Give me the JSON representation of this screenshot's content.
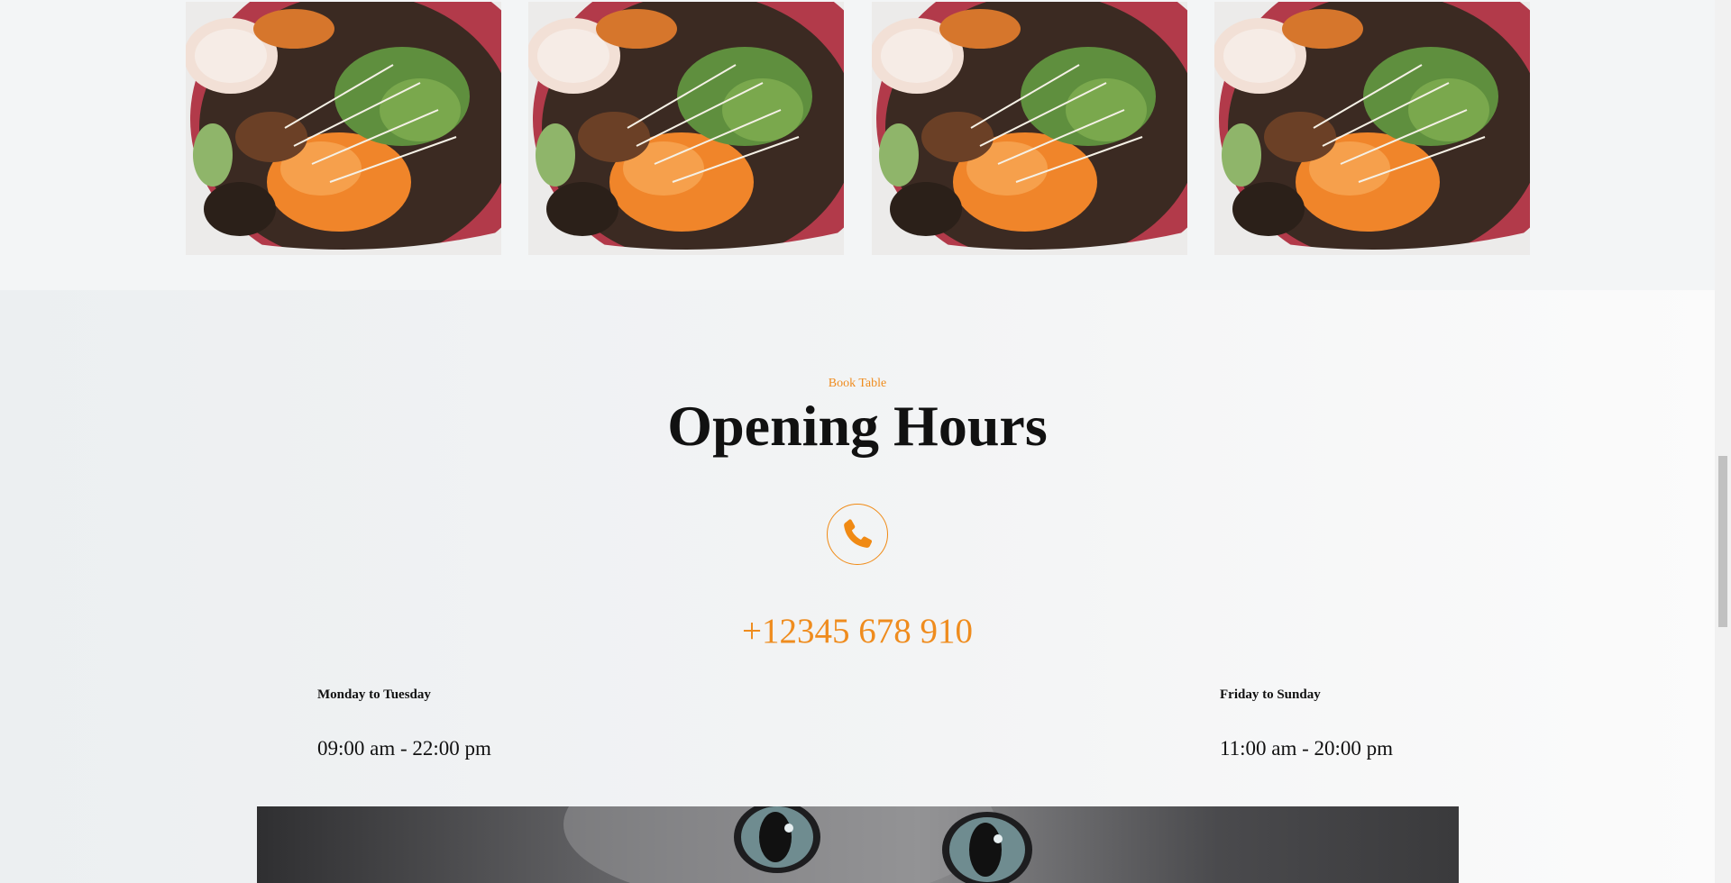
{
  "gallery": {
    "items": [
      {
        "alt": "food-bowl-image"
      },
      {
        "alt": "food-bowl-image"
      },
      {
        "alt": "food-bowl-image"
      },
      {
        "alt": "food-bowl-image"
      }
    ]
  },
  "hours": {
    "eyebrow": "Book Table",
    "title": "Opening Hours",
    "phone": "+12345 678 910",
    "schedule": [
      {
        "days": "Monday to Tuesday",
        "time": "09:00 am - 22:00 pm"
      },
      {
        "days": "Friday to Sunday",
        "time": "11:00 am - 20:00 pm"
      }
    ]
  },
  "colors": {
    "accent": "#ef8c1e",
    "text": "#111111",
    "background": "#f3f5f6"
  },
  "icons": {
    "phone": "phone-icon"
  }
}
